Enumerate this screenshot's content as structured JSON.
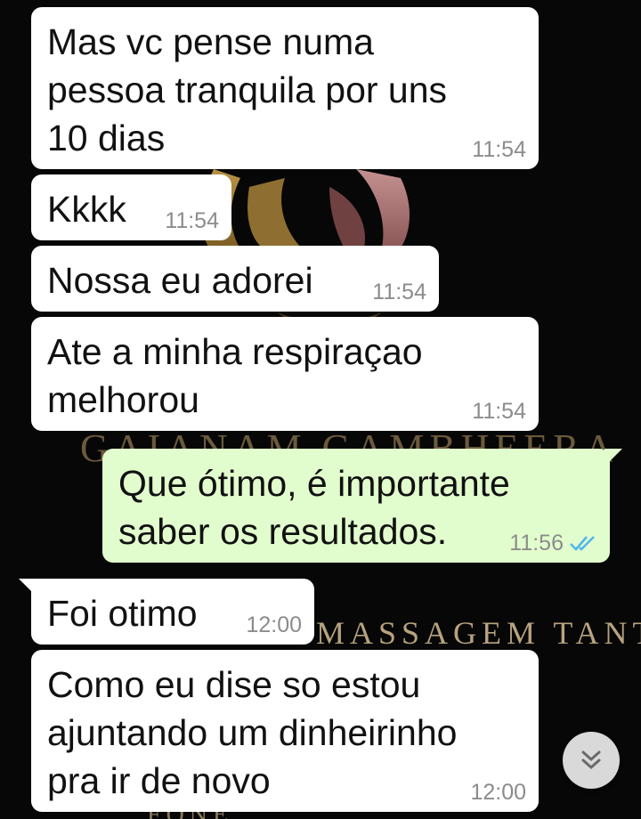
{
  "messages": [
    {
      "text": "Mas vc pense numa\npessoa tranquila por uns\n10 dias",
      "time": "11:54",
      "direction": "incoming"
    },
    {
      "text": "Kkkk",
      "time": "11:54",
      "direction": "incoming"
    },
    {
      "text": "Nossa eu adorei",
      "time": "11:54",
      "direction": "incoming"
    },
    {
      "text": "Ate a minha respiraçao\nmelhorou",
      "time": "11:54",
      "direction": "incoming"
    },
    {
      "text": "Que ótimo, é importante\nsaber os resultados.",
      "time": "11:56",
      "direction": "outgoing",
      "status": "read"
    },
    {
      "text": "Foi otimo",
      "time": "12:00",
      "direction": "incoming"
    },
    {
      "text": "Como eu dise so estou\najuntando um dinheirinho\npra ir de novo",
      "time": "12:00",
      "direction": "incoming"
    }
  ],
  "wallpaper": {
    "line1": "GAIANAM GAMBHEERA",
    "line2": "MASSAGEM TANTRICO",
    "line3": "FONE"
  },
  "icons": {
    "read_ticks": "double-check-icon",
    "scroll_down": "chevron-double-down-icon"
  },
  "colors": {
    "incoming_bubble": "#ffffff",
    "outgoing_bubble": "#e2fdcd",
    "read_ticks": "#4fb6ec",
    "background": "#070707"
  }
}
